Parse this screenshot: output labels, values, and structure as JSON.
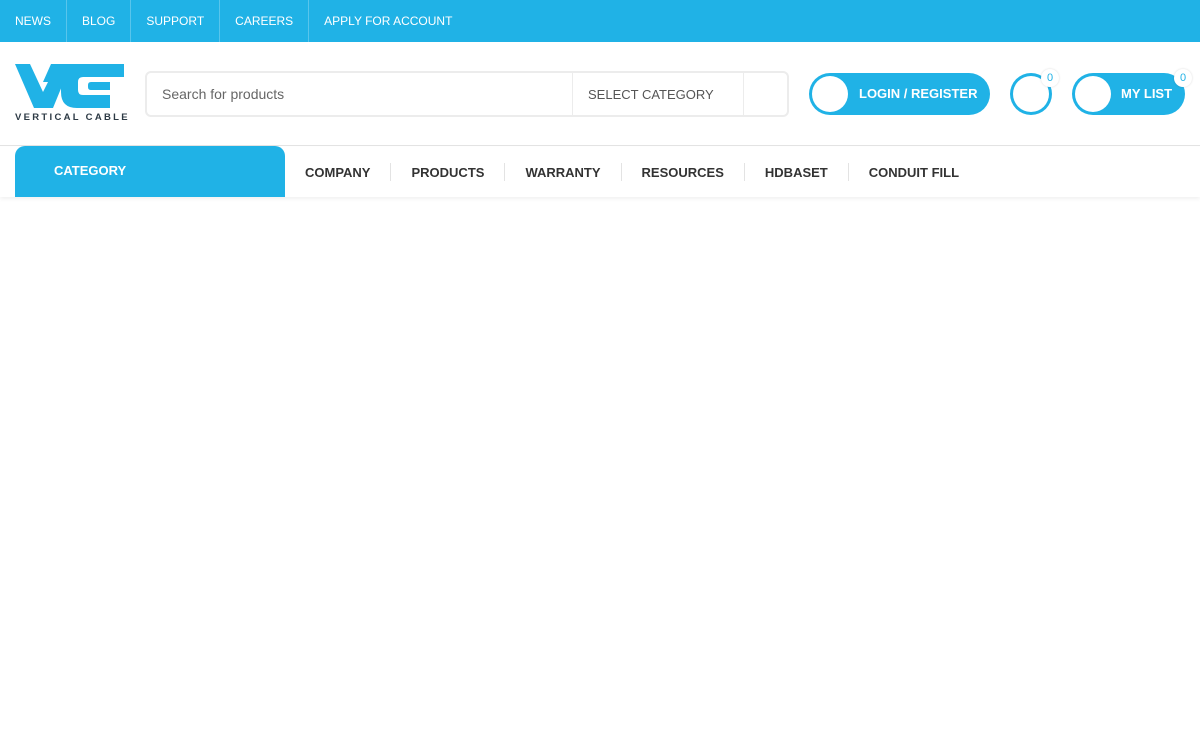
{
  "topbar": {
    "links": [
      "NEWS",
      "BLOG",
      "SUPPORT",
      "CAREERS",
      "APPLY FOR ACCOUNT"
    ]
  },
  "header": {
    "logo_text": "VERTICAL CABLE",
    "search": {
      "placeholder": "Search for products",
      "category": "SELECT CATEGORY"
    },
    "login_label": "LOGIN / REGISTER",
    "compare_count": "0",
    "mylist_label": "MY LIST",
    "mylist_count": "0"
  },
  "nav": {
    "category_label": "CATEGORY",
    "menu": [
      "COMPANY",
      "PRODUCTS",
      "WARRANTY",
      "RESOURCES",
      "HDBASET",
      "CONDUIT FILL"
    ]
  },
  "colors": {
    "brand": "#20b2e6",
    "text": "#333333"
  },
  "icons": {
    "search": "search-icon",
    "user": "user-icon",
    "compare": "compare-icon",
    "list": "list-icon"
  }
}
